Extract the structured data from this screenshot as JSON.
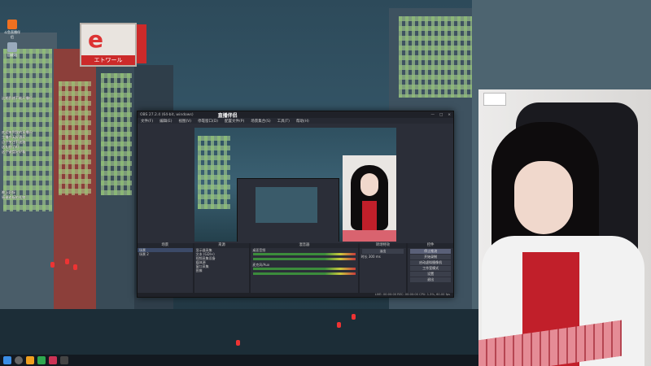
{
  "desktop": {
    "icons": [
      {
        "label": "斗鱼直播伴侣"
      },
      {
        "label": "回收站"
      }
    ],
    "danmaku": [
      "这期我就不能开播吗",
      "欢迎来到我的直播间",
      "主播今天好漂亮",
      "点个关注不迷路",
      "送礼物了吗",
      "这个键盘好好看",
      "晚上好呀",
      "感谢老板的礼物"
    ],
    "sign": {
      "logo": "e",
      "text": "エトワール"
    }
  },
  "obs": {
    "title": "OBS 27.2.4 (64-bit, windows)",
    "watermark": "直播伴侣",
    "menu": [
      "文件(F)",
      "编辑(E)",
      "视图(V)",
      "停靠窗口(D)",
      "配置文件(P)",
      "场景集合(S)",
      "工具(T)",
      "帮助(H)"
    ],
    "panels": {
      "scenes": {
        "title": "场景",
        "items": [
          "场景",
          "场景 2"
        ]
      },
      "sources": {
        "title": "来源",
        "items": [
          "显示器采集",
          "文本 (GDI+)",
          "视频采集设备",
          "媒体源",
          "窗口采集",
          "图像"
        ]
      },
      "mixer": {
        "title": "混音器",
        "items": [
          "桌面音频",
          "麦克风/Aux"
        ]
      },
      "transitions": {
        "title": "转场特效",
        "value": "淡出",
        "duration_label": "时长",
        "duration": "300 ms"
      },
      "controls": {
        "title": "控件",
        "buttons": [
          "停止推流",
          "开始录制",
          "启动虚拟摄像机",
          "工作室模式",
          "设置",
          "退出"
        ]
      }
    },
    "status": "LIVE: 00:00:00  REC: 00:00:00  CPU: 1.3%, 60.00 fps"
  },
  "colors": {
    "accent": "#c11f2a",
    "obs_bg": "#2b2e38",
    "selected": "#3c4a68"
  }
}
